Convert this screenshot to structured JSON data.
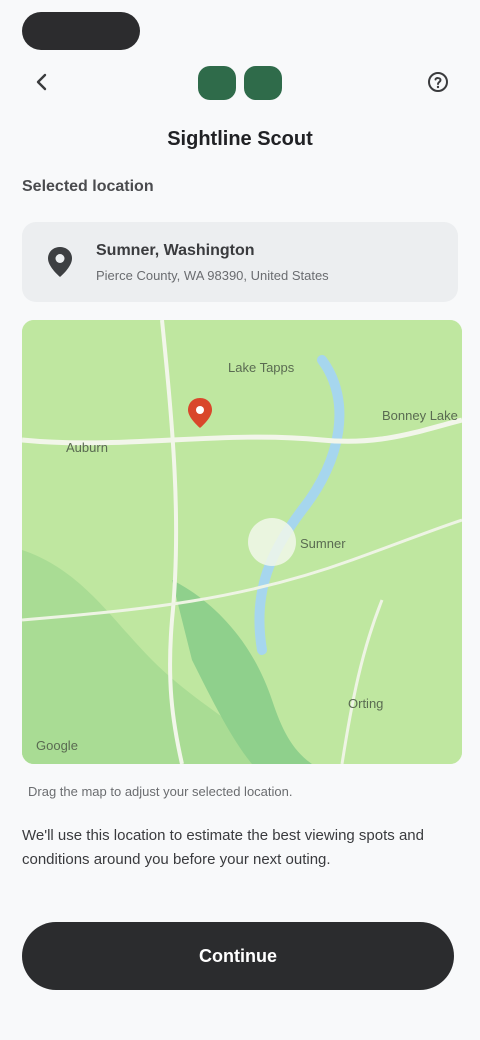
{
  "header": {
    "app_title": "Sightline Scout",
    "back_icon": "arrow-left-icon",
    "help_icon": "question-circle-icon"
  },
  "location": {
    "section_label": "Selected location",
    "address_title": "Sumner, Washington",
    "address_sub": "Pierce County, WA 98390, United States"
  },
  "map": {
    "labels": {
      "north": "Lake Tapps",
      "west": "Auburn",
      "east": "Bonney Lake",
      "center": "Sumner",
      "south": "Orting",
      "attribution": "Google"
    },
    "colors": {
      "land": "#bfe7a0",
      "park": "#8fd08c",
      "water": "#a6d6ee",
      "road": "#f2f6ea",
      "marker": "#d9472b"
    }
  },
  "content": {
    "caption": "Drag the map to adjust your selected location.",
    "body": "We'll use this location to estimate the best viewing spots and conditions around you before your next outing."
  },
  "actions": {
    "primary_label": "Continue"
  }
}
